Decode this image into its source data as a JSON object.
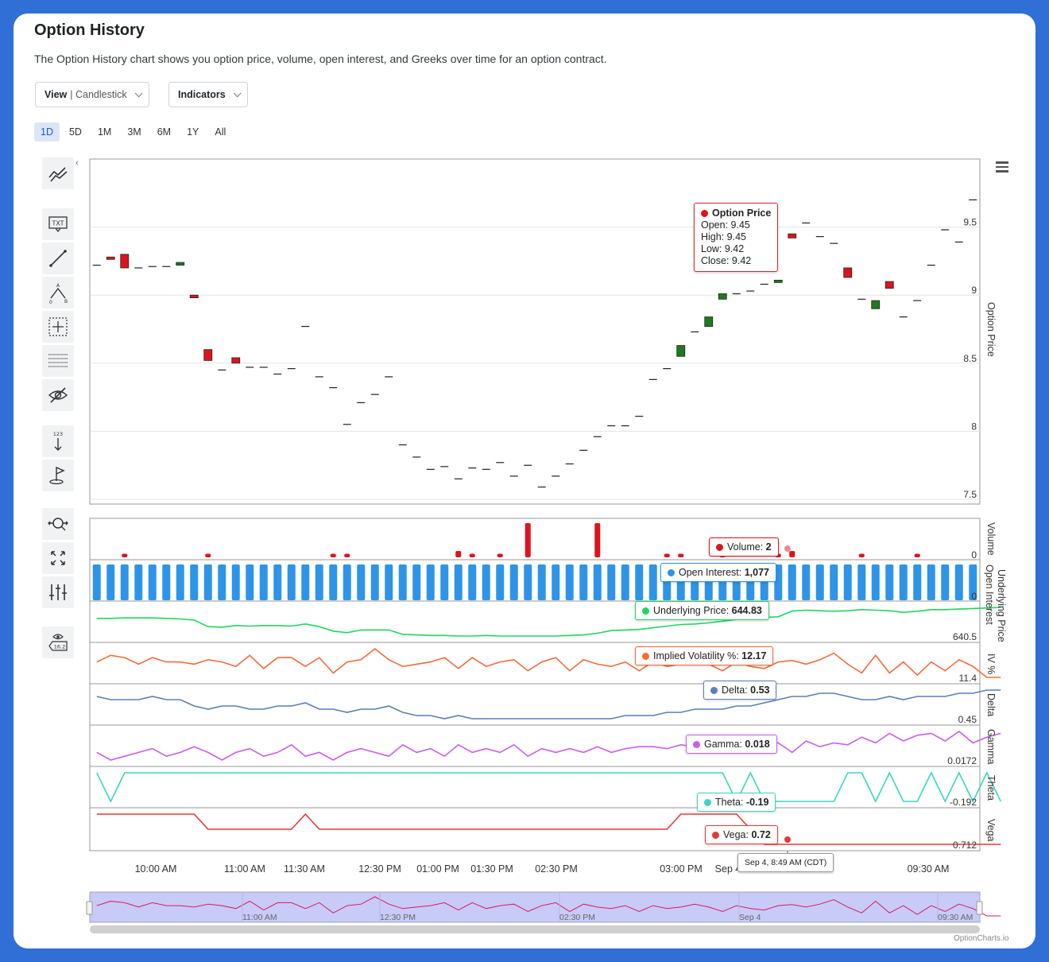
{
  "header": {
    "title": "Option History",
    "description": "The Option History chart shows you option price, volume, open interest, and Greeks over time for an option contract."
  },
  "controls": {
    "view_label": "View",
    "view_value": "| Candlestick",
    "indicators_label": "Indicators",
    "ranges": [
      "1D",
      "5D",
      "1M",
      "3M",
      "6M",
      "1Y",
      "All"
    ],
    "active_range": "1D"
  },
  "toolbar": {
    "icons": [
      "trend-lines-icon",
      "text-annotation-icon",
      "line-segment-icon",
      "pitchfork-icon",
      "measure-icon",
      "fibonacci-icon",
      "hide-drawings-icon",
      "price-label-icon",
      "flag-icon",
      "zoom-pan-icon",
      "fullscreen-icon",
      "indicators-adjust-icon",
      "current-price-indicator-icon"
    ],
    "icon_labels": {
      "text_annotation": "TXT",
      "pitchfork_a": "A",
      "pitchfork_0": "0",
      "pitchfork_b": "B",
      "price_label": "123",
      "current_price": "16.2"
    }
  },
  "tooltips": {
    "option_price": {
      "title": "Option Price",
      "open": "Open: 9.45",
      "high": "High: 9.45",
      "low": "Low: 9.42",
      "close": "Close: 9.42"
    },
    "volume": {
      "label": "Volume: ",
      "value": "2"
    },
    "open_interest": {
      "label": "Open Interest: ",
      "value": "1,077"
    },
    "underlying": {
      "label": "Underlying Price: ",
      "value": "644.83"
    },
    "iv": {
      "label": "Implied Volatility %: ",
      "value": "12.17"
    },
    "delta": {
      "label": "Delta: ",
      "value": "0.53"
    },
    "gamma": {
      "label": "Gamma: ",
      "value": "0.018"
    },
    "theta": {
      "label": "Theta: ",
      "value": "-0.19"
    },
    "vega": {
      "label": "Vega: ",
      "value": "0.72"
    },
    "x_crosshair": "Sep 4, 8:49 AM (CDT)"
  },
  "colors": {
    "up": "#1e7a1e",
    "down": "#e0121e",
    "volume": "#e0121e",
    "open_interest": "#2e94e8",
    "underlying": "#1ed760",
    "iv": "#f26b3a",
    "delta": "#5b7fb8",
    "gamma": "#c95cf0",
    "theta": "#3ad6c0",
    "vega": "#e53935",
    "navigator": "#c8cbf7"
  },
  "brand": "OptionCharts.io",
  "chart_data": {
    "type": "candlestick",
    "x_labels": [
      "10:00 AM",
      "11:00 AM",
      "11:30 AM",
      "12:30 PM",
      "01:00 PM",
      "01:30 PM",
      "02:30 PM",
      "03:00 PM",
      "Sep 4",
      "09:30 AM"
    ],
    "navigator_labels": [
      "11:00 AM",
      "12:30 PM",
      "02:30 PM",
      "Sep 4",
      "09:30 AM"
    ],
    "price_axis": {
      "label": "Option Price",
      "ticks": [
        "9.5",
        "9",
        "8.5",
        "8",
        "7.5"
      ],
      "range": [
        7.5,
        10.0
      ]
    },
    "candles": [
      [
        9.22,
        9.22,
        9.22,
        9.22
      ],
      [
        9.28,
        9.28,
        9.27,
        9.27
      ],
      [
        9.3,
        9.3,
        9.2,
        9.2
      ],
      [
        9.2,
        9.2,
        9.2,
        9.2
      ],
      [
        9.21,
        9.21,
        9.21,
        9.21
      ],
      [
        9.21,
        9.21,
        9.21,
        9.21
      ],
      [
        9.22,
        9.24,
        9.22,
        9.24
      ],
      [
        9.0,
        9.0,
        8.98,
        8.98
      ],
      [
        8.6,
        8.6,
        8.52,
        8.52
      ],
      [
        8.45,
        8.45,
        8.45,
        8.45
      ],
      [
        8.54,
        8.54,
        8.5,
        8.5
      ],
      [
        8.47,
        8.47,
        8.47,
        8.47
      ],
      [
        8.47,
        8.47,
        8.47,
        8.47
      ],
      [
        8.42,
        8.42,
        8.42,
        8.42
      ],
      [
        8.46,
        8.46,
        8.46,
        8.46
      ],
      [
        8.77,
        8.77,
        8.77,
        8.77
      ],
      [
        8.4,
        8.4,
        8.4,
        8.4
      ],
      [
        8.32,
        8.32,
        8.32,
        8.32
      ],
      [
        8.05,
        8.05,
        8.05,
        8.05
      ],
      [
        8.21,
        8.21,
        8.21,
        8.21
      ],
      [
        8.27,
        8.27,
        8.27,
        8.27
      ],
      [
        8.4,
        8.4,
        8.4,
        8.4
      ],
      [
        7.9,
        7.9,
        7.9,
        7.9
      ],
      [
        7.81,
        7.81,
        7.81,
        7.81
      ],
      [
        7.72,
        7.72,
        7.72,
        7.72
      ],
      [
        7.74,
        7.74,
        7.74,
        7.74
      ],
      [
        7.65,
        7.65,
        7.65,
        7.65
      ],
      [
        7.73,
        7.73,
        7.73,
        7.73
      ],
      [
        7.72,
        7.72,
        7.72,
        7.72
      ],
      [
        7.77,
        7.77,
        7.77,
        7.77
      ],
      [
        7.67,
        7.67,
        7.67,
        7.67
      ],
      [
        7.75,
        7.75,
        7.75,
        7.75
      ],
      [
        7.59,
        7.59,
        7.59,
        7.59
      ],
      [
        7.67,
        7.67,
        7.67,
        7.67
      ],
      [
        7.76,
        7.76,
        7.76,
        7.76
      ],
      [
        7.86,
        7.86,
        7.86,
        7.86
      ],
      [
        7.96,
        7.96,
        7.96,
        7.96
      ],
      [
        8.04,
        8.04,
        8.04,
        8.04
      ],
      [
        8.04,
        8.04,
        8.04,
        8.04
      ],
      [
        8.11,
        8.11,
        8.11,
        8.11
      ],
      [
        8.38,
        8.38,
        8.38,
        8.38
      ],
      [
        8.46,
        8.46,
        8.46,
        8.46
      ],
      [
        8.55,
        8.63,
        8.55,
        8.63
      ],
      [
        8.73,
        8.73,
        8.73,
        8.73
      ],
      [
        8.77,
        8.84,
        8.77,
        8.84
      ],
      [
        8.97,
        9.01,
        8.97,
        9.01
      ],
      [
        9.01,
        9.01,
        9.01,
        9.01
      ],
      [
        9.03,
        9.03,
        9.03,
        9.03
      ],
      [
        9.08,
        9.08,
        9.08,
        9.08
      ],
      [
        9.1,
        9.11,
        9.1,
        9.11
      ],
      [
        9.45,
        9.45,
        9.42,
        9.42
      ],
      [
        9.53,
        9.53,
        9.53,
        9.53
      ],
      [
        9.43,
        9.43,
        9.43,
        9.43
      ],
      [
        9.38,
        9.38,
        9.38,
        9.38
      ],
      [
        9.2,
        9.2,
        9.13,
        9.13
      ],
      [
        8.97,
        8.97,
        8.97,
        8.97
      ],
      [
        8.9,
        8.96,
        8.9,
        8.96
      ],
      [
        9.1,
        9.1,
        9.05,
        9.05
      ],
      [
        8.84,
        8.84,
        8.84,
        8.84
      ],
      [
        8.96,
        8.96,
        8.96,
        8.96
      ],
      [
        9.22,
        9.22,
        9.22,
        9.22
      ],
      [
        9.48,
        9.48,
        9.48,
        9.48
      ],
      [
        9.39,
        9.39,
        9.39,
        9.39
      ],
      [
        9.7,
        9.7,
        9.7,
        9.7
      ]
    ],
    "volume": {
      "label": "Volume",
      "tick": "0",
      "values": [
        0,
        0,
        1,
        0,
        0,
        0,
        0,
        0,
        1,
        0,
        0,
        0,
        0,
        0,
        0,
        0,
        0,
        1,
        1,
        0,
        0,
        0,
        0,
        0,
        0,
        0,
        2,
        1,
        0,
        1,
        0,
        12,
        0,
        0,
        0,
        0,
        12,
        0,
        0,
        0,
        0,
        1,
        1,
        0,
        0,
        1,
        0,
        0,
        0,
        1,
        2,
        0,
        0,
        0,
        0,
        1,
        0,
        0,
        0,
        1,
        0,
        0,
        0,
        0,
        0,
        0
      ]
    },
    "open_interest": {
      "label": "Open Interest",
      "tick": "0",
      "value": 1077
    },
    "underlying": {
      "label": "Underlying Price",
      "tick": "640.5",
      "values": [
        643.5,
        643.5,
        643.6,
        643.6,
        643.6,
        643.5,
        643.4,
        643.2,
        642.0,
        641.9,
        642.2,
        642.1,
        642.2,
        642.2,
        642.1,
        642.5,
        642.0,
        641.2,
        640.9,
        641.4,
        641.4,
        641.4,
        640.6,
        640.5,
        640.4,
        640.4,
        640.3,
        640.3,
        640.4,
        640.3,
        640.3,
        640.3,
        640.3,
        640.3,
        640.4,
        640.5,
        640.8,
        641.3,
        641.4,
        641.5,
        641.8,
        642.1,
        642.4,
        642.5,
        642.7,
        643.0,
        643.3,
        643.5,
        643.7,
        643.8,
        644.83,
        645.0,
        644.9,
        644.8,
        644.9,
        645.1,
        645.0,
        644.9,
        644.6,
        644.8,
        645.1,
        645.1,
        645.2,
        645.3,
        645.4,
        645.5
      ]
    },
    "iv": {
      "label": "IV %",
      "tick": "11.4",
      "values": [
        12.1,
        12.4,
        12.3,
        12.0,
        12.3,
        12.1,
        12.1,
        12.0,
        12.2,
        12.1,
        11.9,
        12.4,
        11.8,
        12.3,
        12.3,
        11.9,
        12.3,
        11.6,
        12.1,
        12.2,
        12.7,
        12.2,
        11.9,
        12.0,
        12.1,
        12.3,
        11.8,
        12.3,
        11.9,
        12.1,
        12.2,
        11.7,
        12.1,
        12.3,
        11.7,
        12.2,
        12.0,
        11.9,
        12.1,
        11.7,
        12.1,
        11.9,
        12.0,
        12.2,
        12.0,
        11.7,
        12.1,
        11.9,
        11.8,
        12.1,
        12.17,
        12.0,
        12.2,
        12.5,
        12.0,
        11.6,
        12.4,
        11.6,
        12.1,
        11.5,
        12.1,
        11.7,
        12.2,
        11.9,
        11.4,
        11.4
      ]
    },
    "delta": {
      "label": "Delta",
      "tick": "0.45",
      "values": [
        0.53,
        0.52,
        0.52,
        0.52,
        0.53,
        0.52,
        0.52,
        0.5,
        0.49,
        0.5,
        0.5,
        0.49,
        0.49,
        0.5,
        0.5,
        0.51,
        0.49,
        0.49,
        0.48,
        0.49,
        0.49,
        0.5,
        0.48,
        0.47,
        0.47,
        0.46,
        0.47,
        0.46,
        0.46,
        0.46,
        0.46,
        0.46,
        0.46,
        0.46,
        0.46,
        0.46,
        0.46,
        0.46,
        0.47,
        0.47,
        0.47,
        0.48,
        0.48,
        0.49,
        0.49,
        0.49,
        0.5,
        0.5,
        0.51,
        0.52,
        0.53,
        0.53,
        0.54,
        0.54,
        0.53,
        0.52,
        0.52,
        0.53,
        0.52,
        0.53,
        0.53,
        0.53,
        0.54,
        0.54,
        0.55,
        0.55
      ]
    },
    "gamma": {
      "label": "Gamma",
      "tick": "0.0172",
      "values": [
        0.018,
        0.0176,
        0.0178,
        0.018,
        0.0182,
        0.0178,
        0.018,
        0.0183,
        0.018,
        0.0176,
        0.018,
        0.0182,
        0.0178,
        0.018,
        0.0184,
        0.0178,
        0.018,
        0.0176,
        0.018,
        0.0182,
        0.018,
        0.0178,
        0.0184,
        0.018,
        0.0182,
        0.0178,
        0.0184,
        0.018,
        0.0182,
        0.018,
        0.0184,
        0.0178,
        0.0182,
        0.018,
        0.0182,
        0.018,
        0.0183,
        0.018,
        0.0182,
        0.0183,
        0.0183,
        0.0182,
        0.0184,
        0.0183,
        0.0186,
        0.0183,
        0.0184,
        0.0183,
        0.0186,
        0.0185,
        0.018,
        0.0186,
        0.0183,
        0.0185,
        0.0184,
        0.0188,
        0.0185,
        0.019,
        0.0186,
        0.0189,
        0.019,
        0.0186,
        0.0191,
        0.0185,
        0.0188,
        0.019
      ]
    },
    "theta": {
      "label": "Theta",
      "tick": "-0.192",
      "values": [
        -0.18,
        -0.19,
        -0.18,
        -0.18,
        -0.18,
        -0.18,
        -0.18,
        -0.18,
        -0.18,
        -0.18,
        -0.18,
        -0.18,
        -0.18,
        -0.18,
        -0.18,
        -0.18,
        -0.18,
        -0.18,
        -0.18,
        -0.18,
        -0.18,
        -0.18,
        -0.18,
        -0.18,
        -0.18,
        -0.18,
        -0.18,
        -0.18,
        -0.18,
        -0.18,
        -0.18,
        -0.18,
        -0.18,
        -0.18,
        -0.18,
        -0.18,
        -0.18,
        -0.18,
        -0.18,
        -0.18,
        -0.18,
        -0.18,
        -0.18,
        -0.18,
        -0.18,
        -0.18,
        -0.19,
        -0.18,
        -0.19,
        -0.19,
        -0.19,
        -0.19,
        -0.19,
        -0.19,
        -0.18,
        -0.18,
        -0.19,
        -0.18,
        -0.19,
        -0.19,
        -0.18,
        -0.19,
        -0.18,
        -0.19,
        -0.18,
        -0.19
      ]
    },
    "vega": {
      "label": "Vega",
      "tick": "0.712",
      "values": [
        0.74,
        0.74,
        0.74,
        0.74,
        0.74,
        0.74,
        0.74,
        0.74,
        0.73,
        0.73,
        0.73,
        0.73,
        0.73,
        0.73,
        0.73,
        0.74,
        0.73,
        0.73,
        0.73,
        0.73,
        0.73,
        0.73,
        0.73,
        0.73,
        0.73,
        0.73,
        0.73,
        0.73,
        0.73,
        0.73,
        0.73,
        0.73,
        0.73,
        0.73,
        0.73,
        0.73,
        0.73,
        0.73,
        0.73,
        0.73,
        0.73,
        0.73,
        0.74,
        0.74,
        0.74,
        0.74,
        0.74,
        0.73,
        0.72,
        0.72,
        0.72,
        0.72,
        0.72,
        0.72,
        0.72,
        0.72,
        0.72,
        0.72,
        0.72,
        0.72,
        0.72,
        0.72,
        0.72,
        0.72,
        0.72,
        0.72
      ]
    }
  }
}
